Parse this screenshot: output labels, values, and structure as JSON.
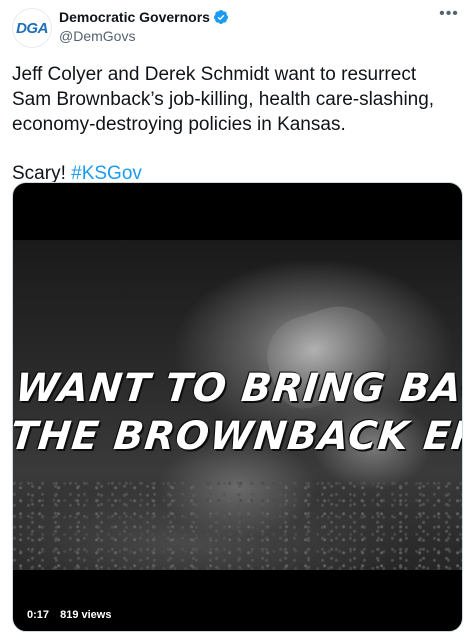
{
  "author": {
    "avatar_text": "DGA",
    "display_name": "Democratic Governors",
    "handle": "@DemGovs",
    "verified": true
  },
  "tweet": {
    "text_main": "Jeff Colyer and Derek Schmidt want to resurrect Sam Brownback’s job-killing, health care-slashing, economy-destroying policies in Kansas.",
    "text_second_prefix": "Scary!",
    "hashtag": "#KSGov"
  },
  "video": {
    "overlay_line_1": "WANT TO BRING BACK",
    "overlay_line_2": "THE BROWNBACK ERA...",
    "duration": "0:17",
    "views": "819 views"
  },
  "icons": {
    "verified": "verified-badge-icon",
    "more": "more-options-icon"
  },
  "colors": {
    "link": "#1d9bf0",
    "verified": "#1d9bf0",
    "text": "#0f1419",
    "muted": "#536471"
  }
}
